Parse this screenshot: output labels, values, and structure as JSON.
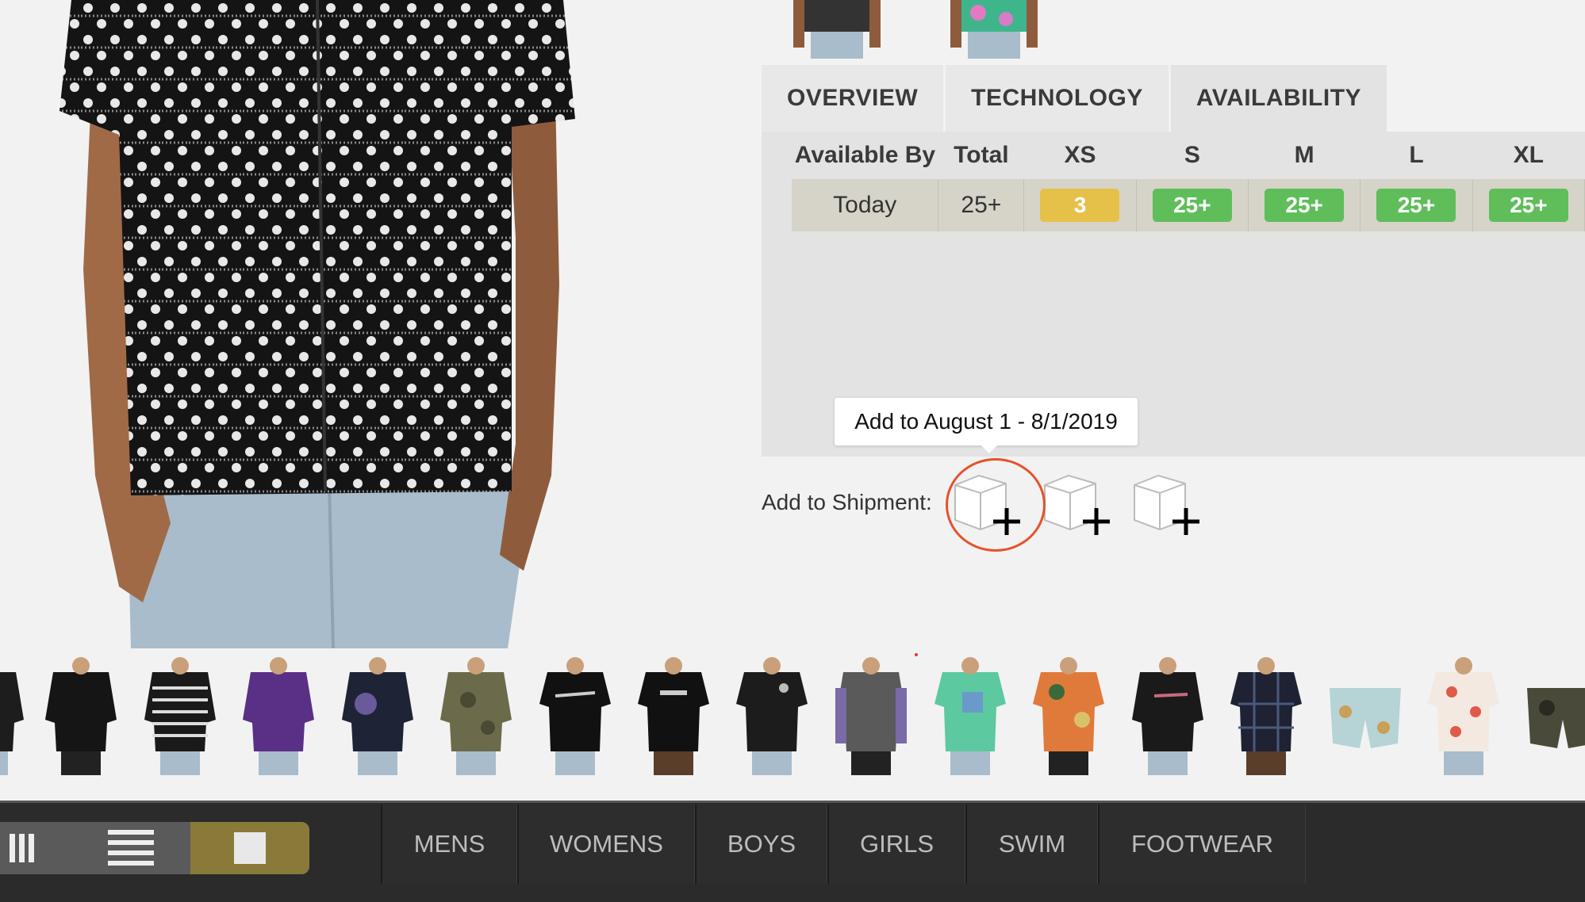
{
  "tabs": [
    {
      "label": "OVERVIEW",
      "active": false
    },
    {
      "label": "TECHNOLOGY",
      "active": false
    },
    {
      "label": "AVAILABILITY",
      "active": true
    }
  ],
  "availability": {
    "headers": [
      "Available By",
      "Total",
      "XS",
      "S",
      "M",
      "L",
      "XL"
    ],
    "row": {
      "available_by": "Today",
      "total": "25+",
      "sizes": [
        {
          "size": "XS",
          "qty": "3",
          "status": "low"
        },
        {
          "size": "S",
          "qty": "25+",
          "status": "high"
        },
        {
          "size": "M",
          "qty": "25+",
          "status": "high"
        },
        {
          "size": "L",
          "qty": "25+",
          "status": "high"
        },
        {
          "size": "XL",
          "qty": "25+",
          "status": "high"
        }
      ]
    },
    "status_colors": {
      "low": "#e6c14a",
      "high": "#5fbe5a"
    }
  },
  "shipment": {
    "label": "Add to Shipment:",
    "tooltip": "Add to August 1 - 8/1/2019",
    "buttons": [
      {
        "icon": "box-plus-icon"
      },
      {
        "icon": "box-plus-icon"
      },
      {
        "icon": "box-plus-icon"
      }
    ],
    "highlight_color": "#e5522c"
  },
  "strip": {
    "items": [
      "black-shirt",
      "black-jacket",
      "striped-tee",
      "purple-shirt",
      "tie-dye-hoodie",
      "camo-shirt",
      "black-graphic-tee",
      "black-logo-tee",
      "black-tee",
      "acid-wash-longsleeve",
      "mint-tee",
      "floral-shirt",
      "black-longsleeve",
      "plaid-shirt",
      "patterned-boardshorts",
      "printed-shirt",
      "camo-shorts"
    ]
  },
  "nav": {
    "view_icons": [
      "columns-view-icon",
      "list-view-icon",
      "single-view-icon"
    ],
    "categories": [
      "MENS",
      "WOMENS",
      "BOYS",
      "GIRLS",
      "SWIM",
      "FOOTWEAR"
    ],
    "accent": "#8a7a3a"
  }
}
